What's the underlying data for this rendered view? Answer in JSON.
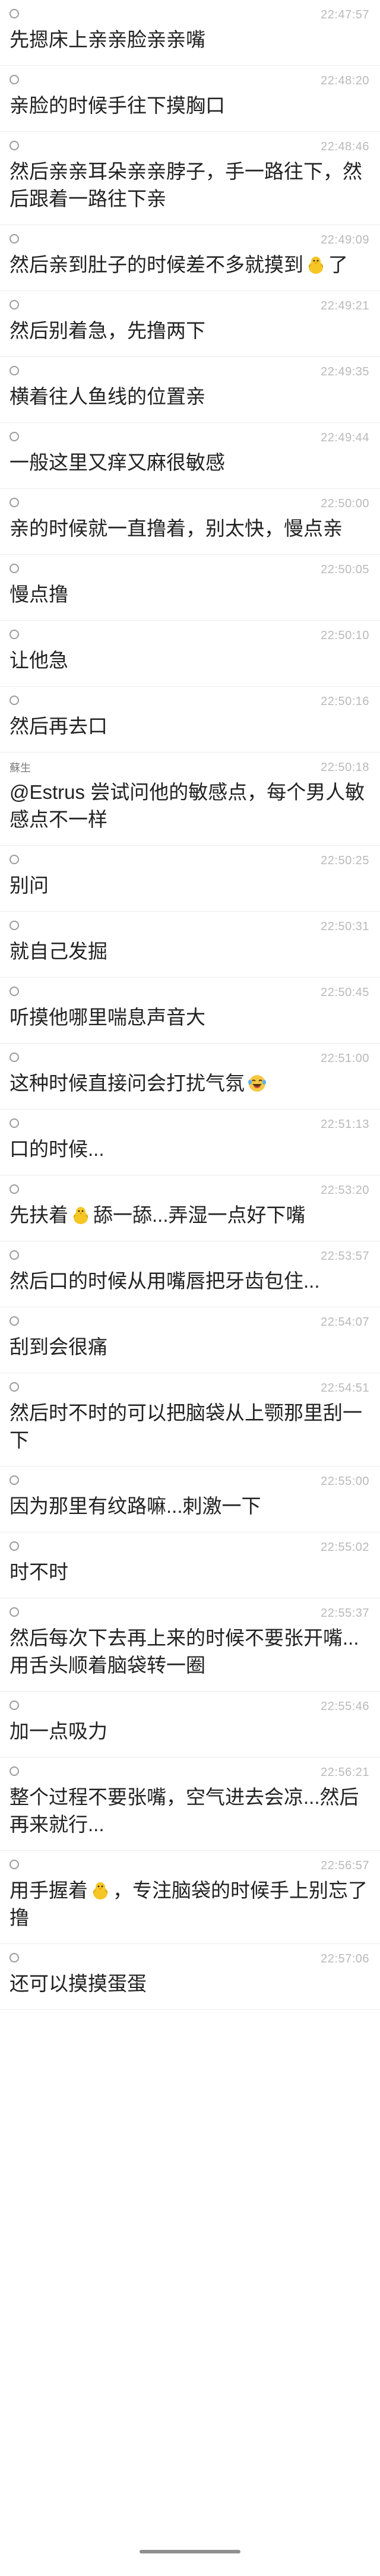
{
  "messages": [
    {
      "time": "22:47:57",
      "sender": "",
      "parts": [
        {
          "t": "先摁床上亲亲脸亲亲嘴"
        }
      ]
    },
    {
      "time": "22:48:20",
      "sender": "",
      "parts": [
        {
          "t": "亲脸的时候手往下摸胸口"
        }
      ]
    },
    {
      "time": "22:48:46",
      "sender": "",
      "parts": [
        {
          "t": "然后亲亲耳朵亲亲脖子，手一路往下，然后跟着一路往下亲"
        }
      ]
    },
    {
      "time": "22:49:09",
      "sender": "",
      "parts": [
        {
          "t": "然后亲到肚子的时候差不多就摸到"
        },
        {
          "emoji": "chick-emoji-icon"
        },
        {
          "t": "了"
        }
      ]
    },
    {
      "time": "22:49:21",
      "sender": "",
      "parts": [
        {
          "t": "然后别着急，先撸两下"
        }
      ]
    },
    {
      "time": "22:49:35",
      "sender": "",
      "parts": [
        {
          "t": "横着往人鱼线的位置亲"
        }
      ]
    },
    {
      "time": "22:49:44",
      "sender": "",
      "parts": [
        {
          "t": "一般这里又痒又麻很敏感"
        }
      ]
    },
    {
      "time": "22:50:00",
      "sender": "",
      "parts": [
        {
          "t": "亲的时候就一直撸着，别太快，慢点亲"
        }
      ]
    },
    {
      "time": "22:50:05",
      "sender": "",
      "parts": [
        {
          "t": "慢点撸"
        }
      ]
    },
    {
      "time": "22:50:10",
      "sender": "",
      "parts": [
        {
          "t": "让他急"
        }
      ]
    },
    {
      "time": "22:50:16",
      "sender": "",
      "parts": [
        {
          "t": "然后再去口"
        }
      ]
    },
    {
      "time": "22:50:18",
      "sender": "蘇生",
      "parts": [
        {
          "t": "@Estrus 尝试问他的敏感点，每个男人敏感点不一样"
        }
      ]
    },
    {
      "time": "22:50:25",
      "sender": "",
      "parts": [
        {
          "t": "别问"
        }
      ]
    },
    {
      "time": "22:50:31",
      "sender": "",
      "parts": [
        {
          "t": "就自己发掘"
        }
      ]
    },
    {
      "time": "22:50:45",
      "sender": "",
      "parts": [
        {
          "t": "听摸他哪里喘息声音大"
        }
      ]
    },
    {
      "time": "22:51:00",
      "sender": "",
      "parts": [
        {
          "t": "这种时候直接问会打扰气氛"
        },
        {
          "emoji": "laugh-cry-emoji-icon"
        }
      ]
    },
    {
      "time": "22:51:13",
      "sender": "",
      "parts": [
        {
          "t": "口的时候..."
        }
      ]
    },
    {
      "time": "22:53:20",
      "sender": "",
      "parts": [
        {
          "t": "先扶着"
        },
        {
          "emoji": "chick-emoji-icon"
        },
        {
          "t": "舔一舔...弄湿一点好下嘴"
        }
      ]
    },
    {
      "time": "22:53:57",
      "sender": "",
      "parts": [
        {
          "t": "然后口的时候从用嘴唇把牙齿包住..."
        }
      ]
    },
    {
      "time": "22:54:07",
      "sender": "",
      "parts": [
        {
          "t": "刮到会很痛"
        }
      ]
    },
    {
      "time": "22:54:51",
      "sender": "",
      "parts": [
        {
          "t": "然后时不时的可以把脑袋从上颚那里刮一下"
        }
      ]
    },
    {
      "time": "22:55:00",
      "sender": "",
      "parts": [
        {
          "t": "因为那里有纹路嘛...刺激一下"
        }
      ]
    },
    {
      "time": "22:55:02",
      "sender": "",
      "parts": [
        {
          "t": "时不时"
        }
      ]
    },
    {
      "time": "22:55:37",
      "sender": "",
      "parts": [
        {
          "t": "然后每次下去再上来的时候不要张开嘴...用舌头顺着脑袋转一圈"
        }
      ]
    },
    {
      "time": "22:55:46",
      "sender": "",
      "parts": [
        {
          "t": "加一点吸力"
        }
      ]
    },
    {
      "time": "22:56:21",
      "sender": "",
      "parts": [
        {
          "t": "整个过程不要张嘴，空气进去会凉...然后再来就行..."
        }
      ]
    },
    {
      "time": "22:56:57",
      "sender": "",
      "parts": [
        {
          "t": "用手握着"
        },
        {
          "emoji": "chick-emoji-icon"
        },
        {
          "t": "，专注脑袋的时候手上别忘了撸"
        }
      ]
    },
    {
      "time": "22:57:06",
      "sender": "",
      "parts": [
        {
          "t": "还可以摸摸蛋蛋"
        }
      ]
    }
  ],
  "colors": {
    "chick": "#f6c624",
    "beak": "#ef8c1e",
    "laugh": "#f7c843"
  }
}
